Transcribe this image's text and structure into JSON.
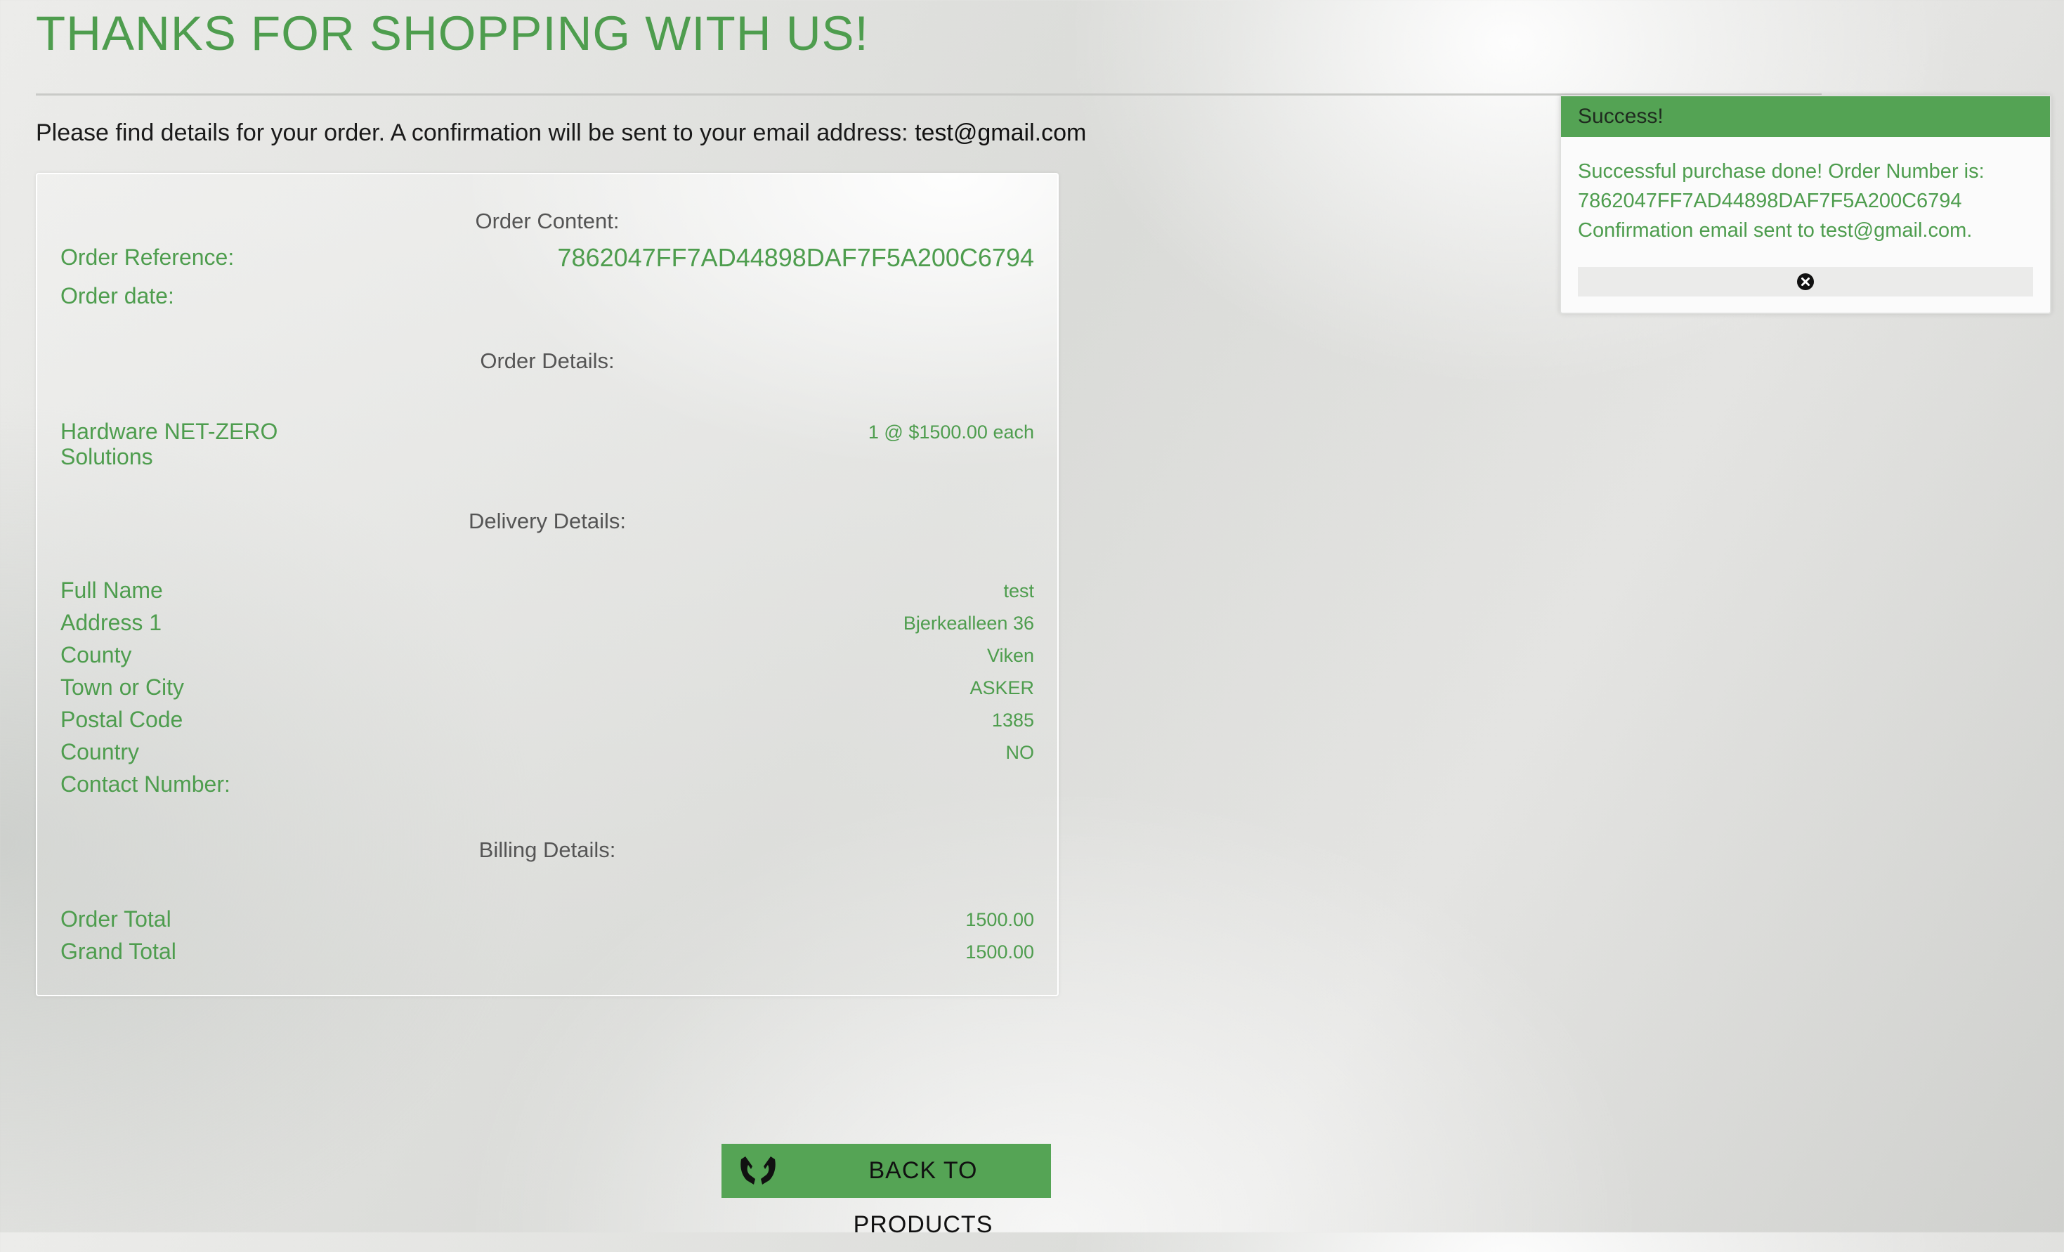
{
  "header": {
    "title": "THANKS FOR SHOPPING WITH US!",
    "intro_text": "Please find details for your order. A confirmation will be sent to your email address: ",
    "intro_email": "test@gmail.com"
  },
  "order": {
    "content_heading": "Order Content:",
    "reference_label": "Order Reference:",
    "reference_value": "7862047FF7AD44898DAF7F5A200C6794",
    "date_label": "Order date:",
    "details_heading": "Order Details:",
    "item_name": "Hardware NET-ZERO Solutions",
    "item_name_line1": "Hardware NET-ZERO",
    "item_name_line2": "Solutions",
    "item_qty_price": "1 @ $1500.00 each",
    "delivery_heading": "Delivery Details:",
    "delivery": [
      {
        "label": "Full Name",
        "value": "test"
      },
      {
        "label": "Address 1",
        "value": "Bjerkealleen 36"
      },
      {
        "label": "County",
        "value": "Viken"
      },
      {
        "label": "Town or City",
        "value": "ASKER"
      },
      {
        "label": "Postal Code",
        "value": "1385"
      },
      {
        "label": "Country",
        "value": "NO"
      },
      {
        "label": "Contact Number:",
        "value": ""
      }
    ],
    "billing_heading": "Billing Details:",
    "billing": [
      {
        "label": "Order Total",
        "value": "1500.00"
      },
      {
        "label": "Grand Total",
        "value": "1500.00"
      }
    ]
  },
  "toast": {
    "header": "Success!",
    "line1": "Successful purchase done! Order Number is:",
    "line2": "7862047FF7AD44898DAF7F5A200C6794",
    "line3": "Confirmation email sent to test@gmail.com.",
    "close_icon": "close-circle-icon"
  },
  "back_button": {
    "label": "BACK TO PRODUCTS",
    "icon": "hands-icon"
  },
  "colors": {
    "accent_green": "#4e9d4e",
    "button_green": "#55a455",
    "toast_header_green": "#54a354"
  }
}
